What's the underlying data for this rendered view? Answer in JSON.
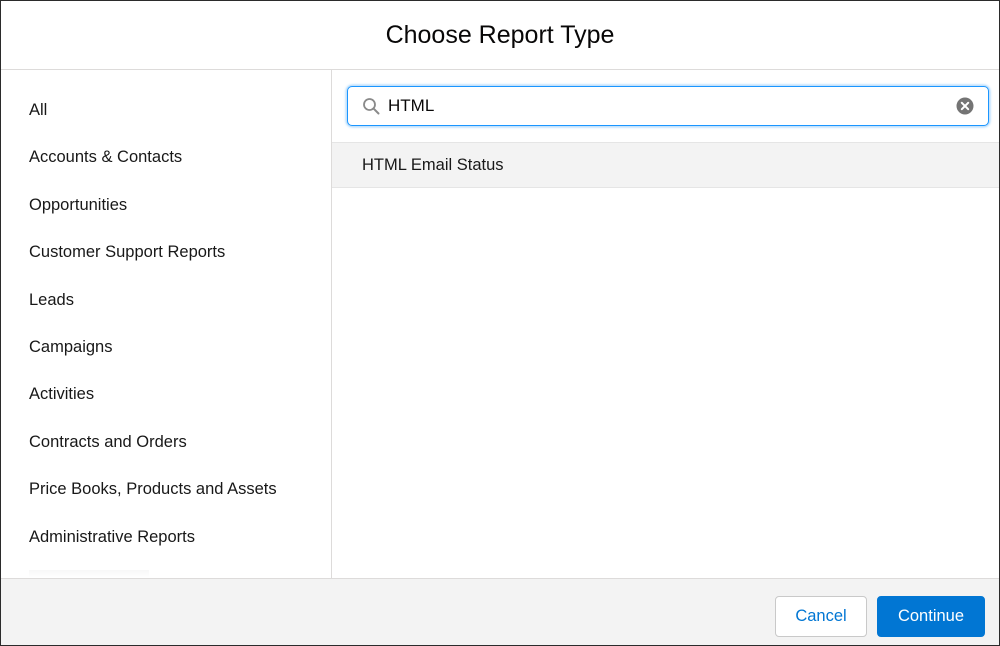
{
  "header": {
    "title": "Choose Report Type"
  },
  "sidebar": {
    "items": [
      {
        "label": "All"
      },
      {
        "label": "Accounts & Contacts"
      },
      {
        "label": "Opportunities"
      },
      {
        "label": "Customer Support Reports"
      },
      {
        "label": "Leads"
      },
      {
        "label": "Campaigns"
      },
      {
        "label": "Activities"
      },
      {
        "label": "Contracts and Orders"
      },
      {
        "label": "Price Books, Products and Assets"
      },
      {
        "label": "Administrative Reports"
      }
    ]
  },
  "search": {
    "value": "HTML",
    "icon": "search-icon",
    "clear_icon": "clear-icon",
    "focus_color": "#1b96ff"
  },
  "results": [
    {
      "label": "HTML Email Status"
    }
  ],
  "footer": {
    "cancel_label": "Cancel",
    "continue_label": "Continue",
    "brand_color": "#0176d3"
  }
}
